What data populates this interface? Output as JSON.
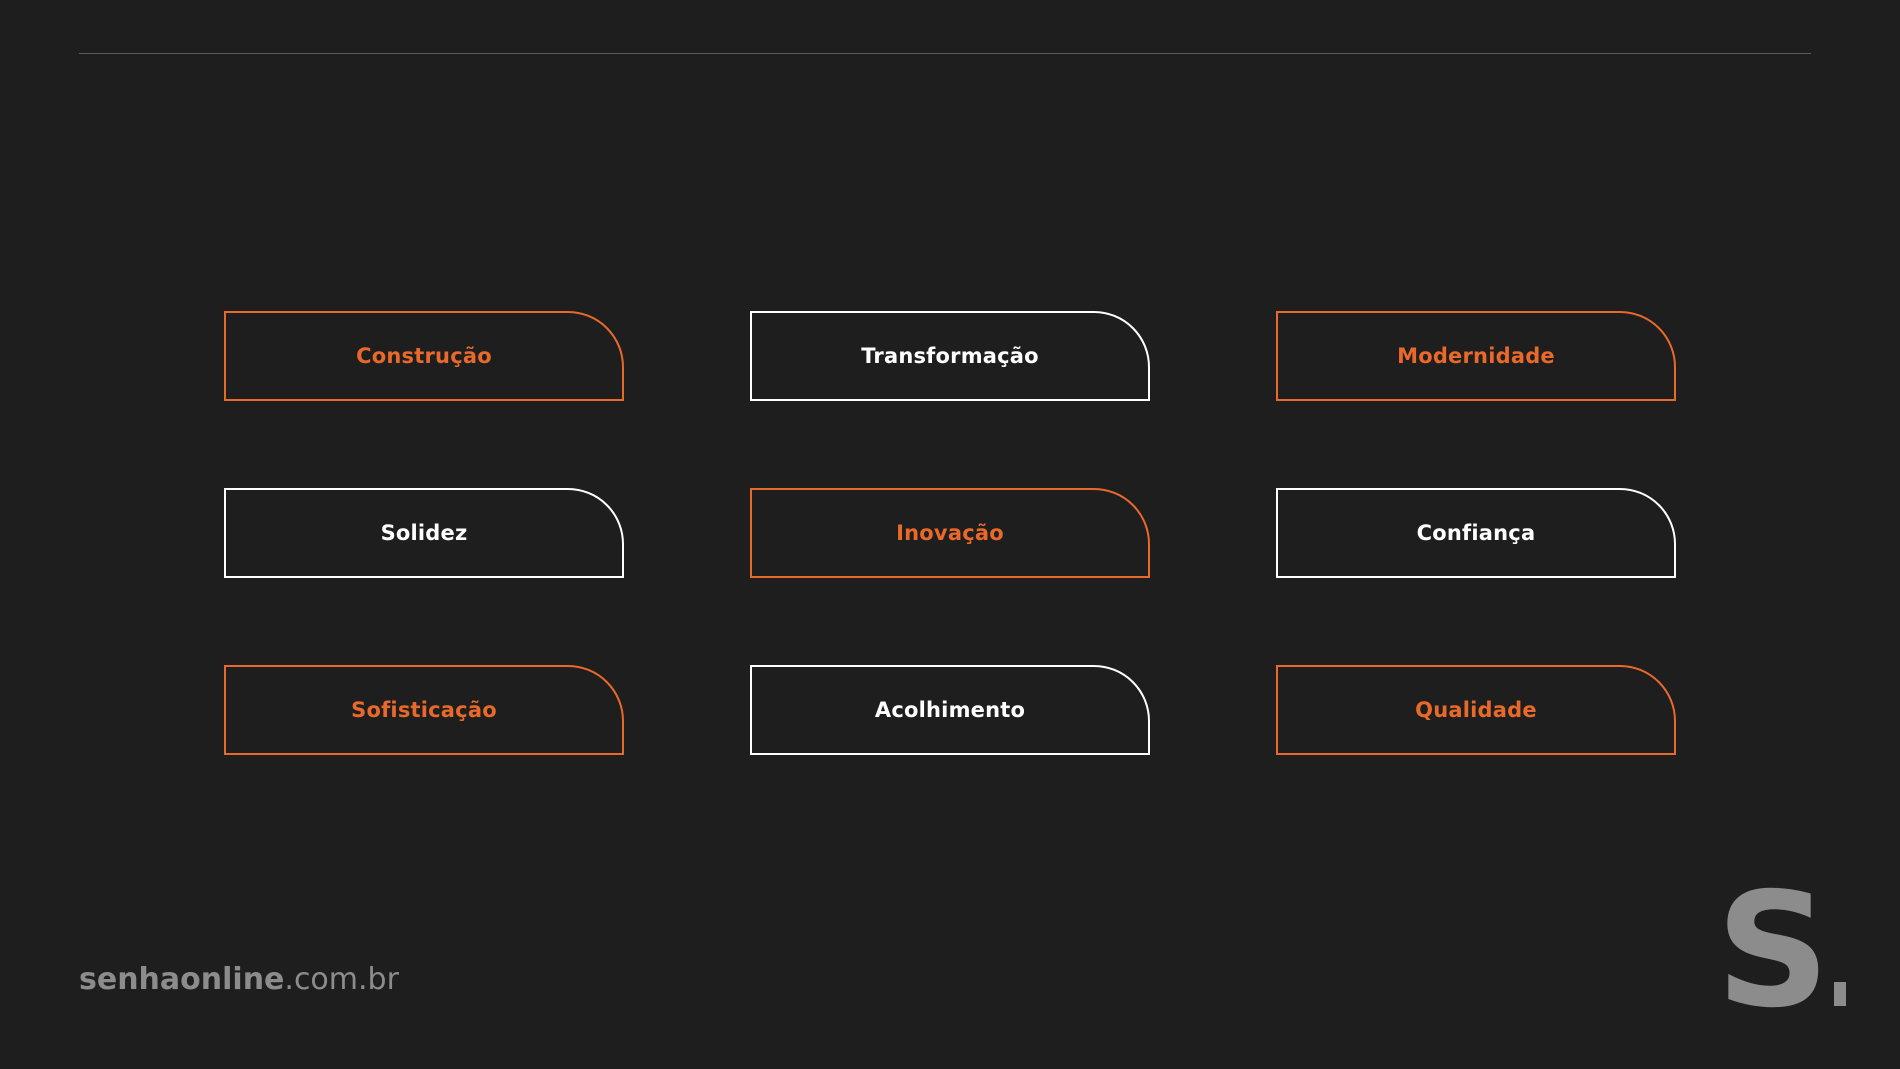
{
  "tags": [
    {
      "label": "Construção",
      "accent": true
    },
    {
      "label": "Transformação",
      "accent": false
    },
    {
      "label": "Modernidade",
      "accent": true
    },
    {
      "label": "Solidez",
      "accent": false
    },
    {
      "label": "Inovação",
      "accent": true
    },
    {
      "label": "Confiança",
      "accent": false
    },
    {
      "label": "Sofisticação",
      "accent": true
    },
    {
      "label": "Acolhimento",
      "accent": false
    },
    {
      "label": "Qualidade",
      "accent": true
    }
  ],
  "footer": {
    "site_name": "senhaonline",
    "site_domain": ".com.br"
  },
  "logo": {
    "letter": "S"
  },
  "colors": {
    "background": "#1e1e1e",
    "accent": "#e8692a",
    "outline": "#ffffff",
    "muted": "#8c8c8c"
  }
}
